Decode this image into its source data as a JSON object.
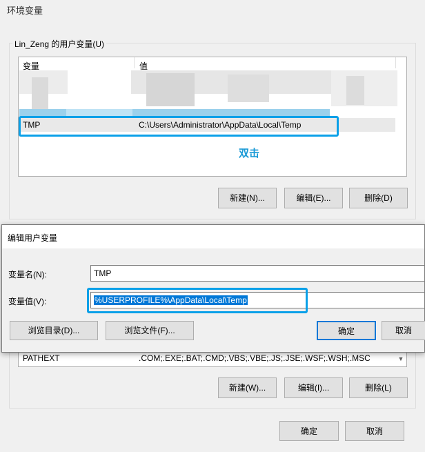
{
  "window": {
    "title": "环境变量"
  },
  "user_vars": {
    "group_label": "Lin_Zeng 的用户变量(U)",
    "columns": [
      "变量",
      "值"
    ],
    "selected_row": {
      "name": "TMP",
      "value": "C:\\Users\\Administrator\\AppData\\Local\\Temp"
    },
    "annotation": "双击",
    "buttons": {
      "new": "新建(N)...",
      "edit": "编辑(E)...",
      "delete": "删除(D)"
    }
  },
  "edit_dialog": {
    "title": "编辑用户变量",
    "name_label": "变量名(N):",
    "name_value": "TMP",
    "value_label": "变量值(V):",
    "value_value": "%USERPROFILE%\\AppData\\Local\\Temp",
    "buttons": {
      "browse_dir": "浏览目录(D)...",
      "browse_file": "浏览文件(F)...",
      "ok": "确定",
      "cancel": "取消"
    }
  },
  "system_vars": {
    "row": {
      "name": "PATHEXT",
      "value": ".COM;.EXE;.BAT;.CMD;.VBS;.VBE;.JS;.JSE;.WSF;.WSH;.MSC"
    },
    "buttons": {
      "new": "新建(W)...",
      "edit": "编辑(I)...",
      "delete": "删除(L)"
    }
  },
  "footer": {
    "ok": "确定",
    "cancel": "取消"
  },
  "colors": {
    "highlight": "#0aa0e8",
    "selection": "#0078d7",
    "annotation": "#1a9ad6"
  }
}
